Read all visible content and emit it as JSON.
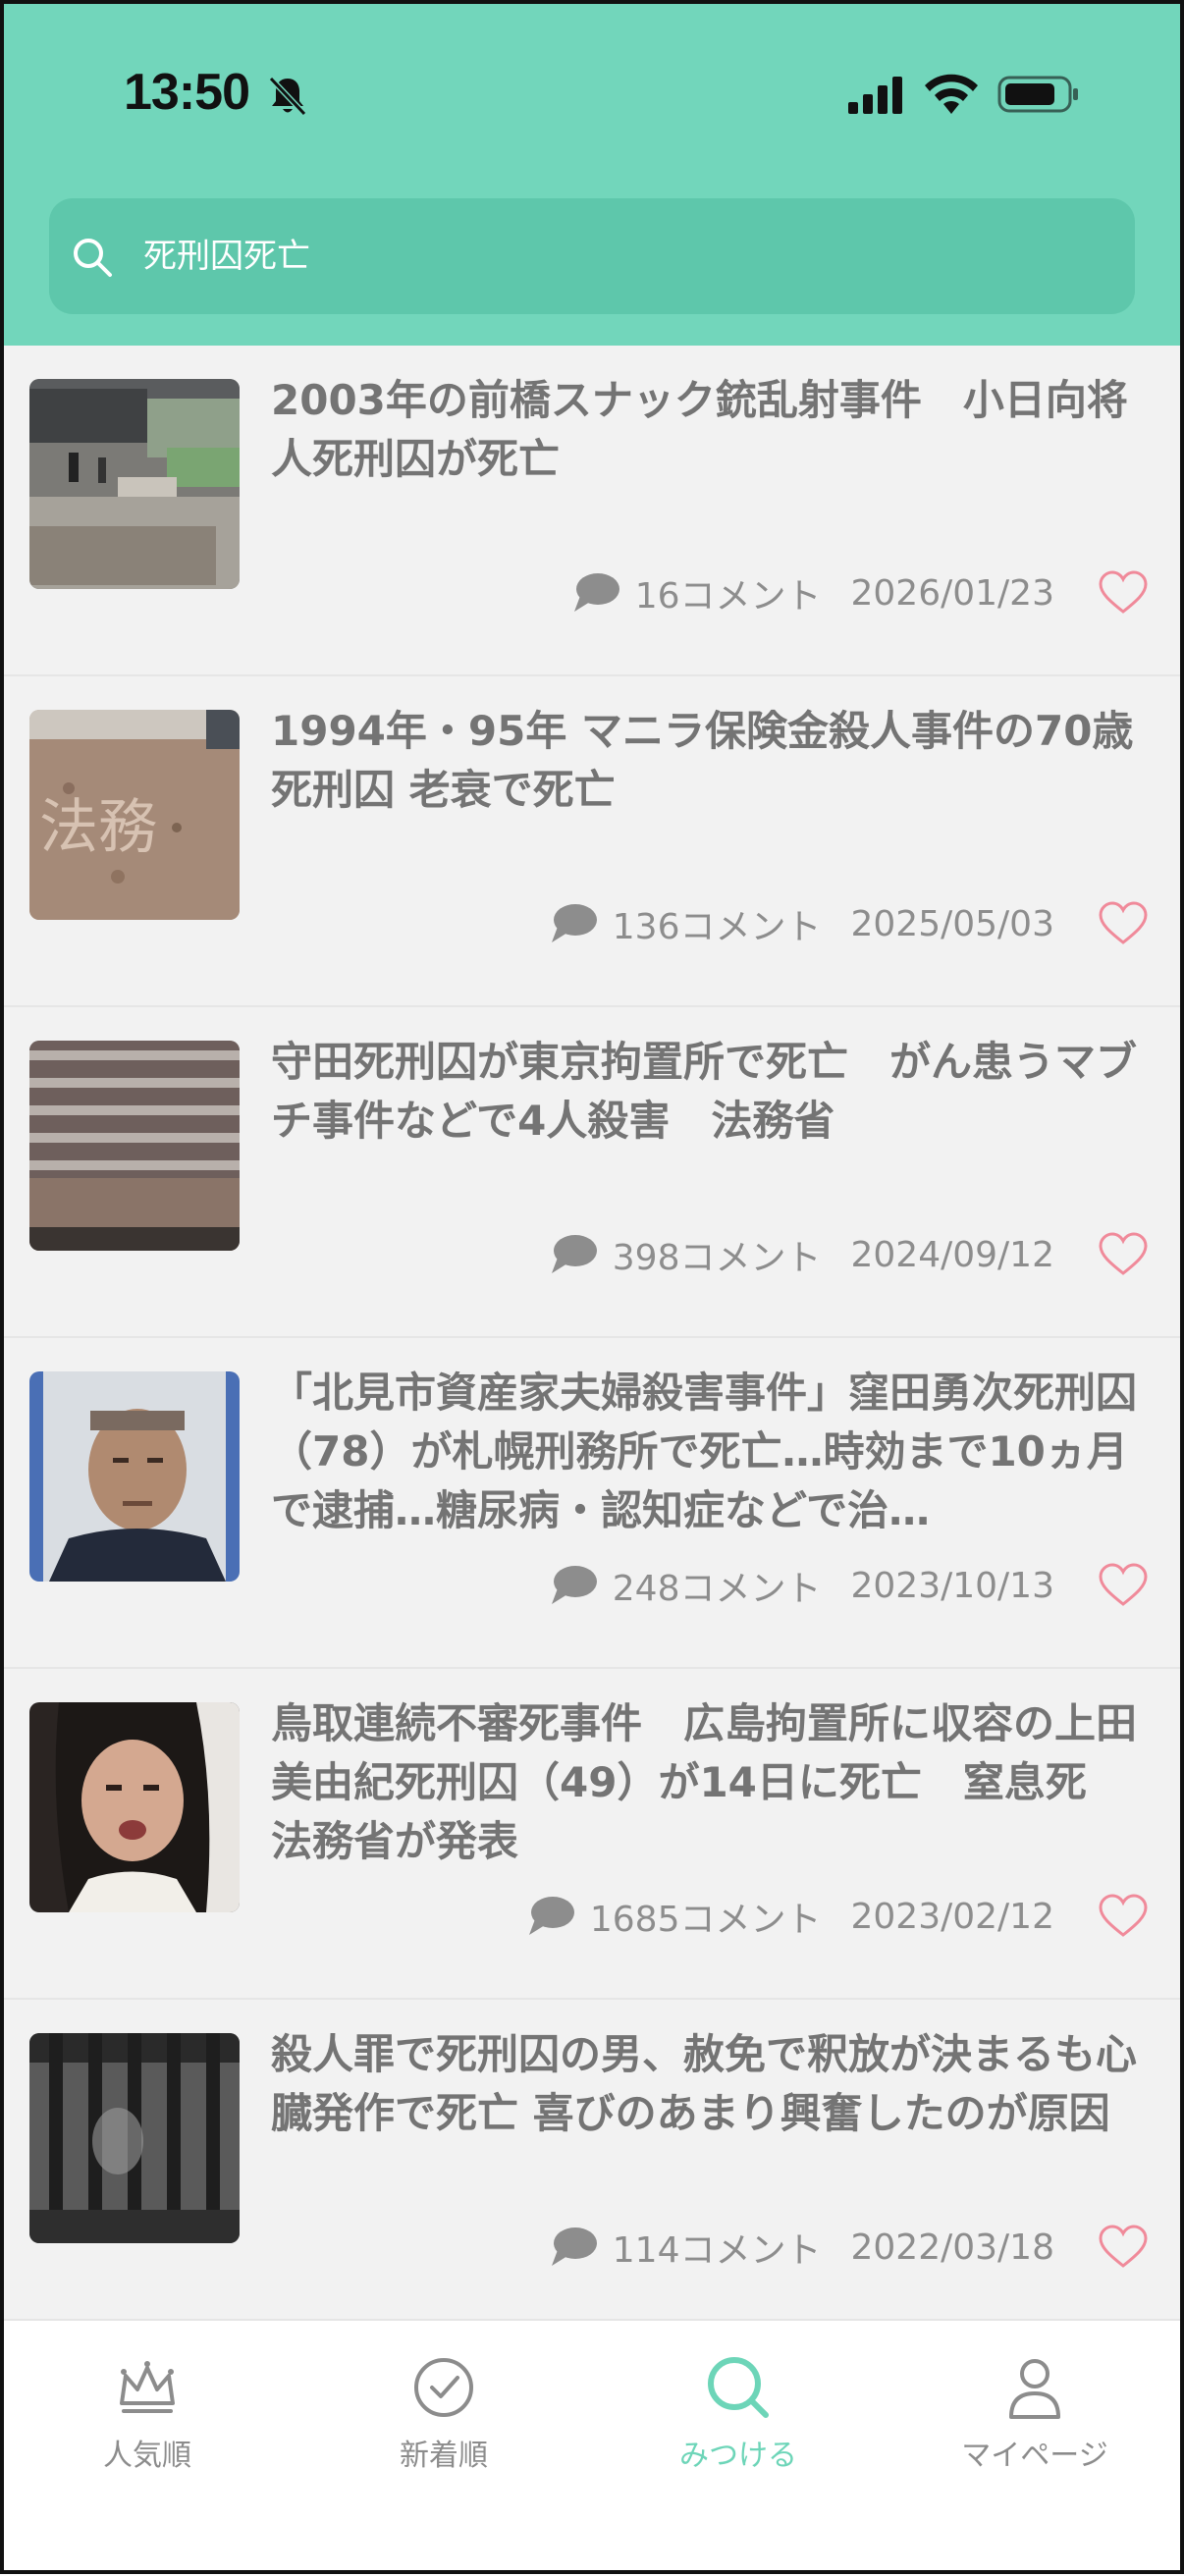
{
  "status": {
    "time": "13:50"
  },
  "search": {
    "query": "死刑囚死亡"
  },
  "colors": {
    "accent": "#72d6bb",
    "search_bg": "#5ec7ab",
    "heart": "#f08a9a",
    "active_tab": "#6dd5b8"
  },
  "articles": [
    {
      "title": "2003年の前橋スナック銃乱射事件　小日向将人死刑囚が死亡",
      "comments": "16コメント",
      "date": "2026/01/23",
      "thumb": "building-entrance-photo"
    },
    {
      "title": "1994年・95年 マニラ保険金殺人事件の70歳死刑囚 老衰で死亡",
      "comments": "136コメント",
      "date": "2025/05/03",
      "thumb": "ministry-stone-sign-photo"
    },
    {
      "title": "守田死刑囚が東京拘置所で死亡　がん患うマブチ事件などで4人殺害　法務省",
      "comments": "398コメント",
      "date": "2024/09/12",
      "thumb": "ministry-building-photo"
    },
    {
      "title": "「北見市資産家夫婦殺害事件」窪田勇次死刑囚（78）が札幌刑務所で死亡…時効まで10ヵ月で逮捕…糖尿病・認知症などで治…",
      "comments": "248コメント",
      "date": "2023/10/13",
      "thumb": "man-portrait-photo"
    },
    {
      "title": "鳥取連続不審死事件　広島拘置所に収容の上田美由紀死刑囚（49）が14日に死亡　窒息死　法務省が発表",
      "comments": "1685コメント",
      "date": "2023/02/12",
      "thumb": "woman-portrait-photo"
    },
    {
      "title": "殺人罪で死刑囚の男、赦免で釈放が決まるも心臓発作で死亡 喜びのあまり興奮したのが原因",
      "comments": "114コメント",
      "date": "2022/03/18",
      "thumb": "prison-bars-photo"
    }
  ],
  "tabs": [
    {
      "label": "人気順",
      "icon": "crown-icon"
    },
    {
      "label": "新着順",
      "icon": "clock-icon"
    },
    {
      "label": "みつける",
      "icon": "search-icon"
    },
    {
      "label": "マイページ",
      "icon": "person-icon"
    }
  ]
}
